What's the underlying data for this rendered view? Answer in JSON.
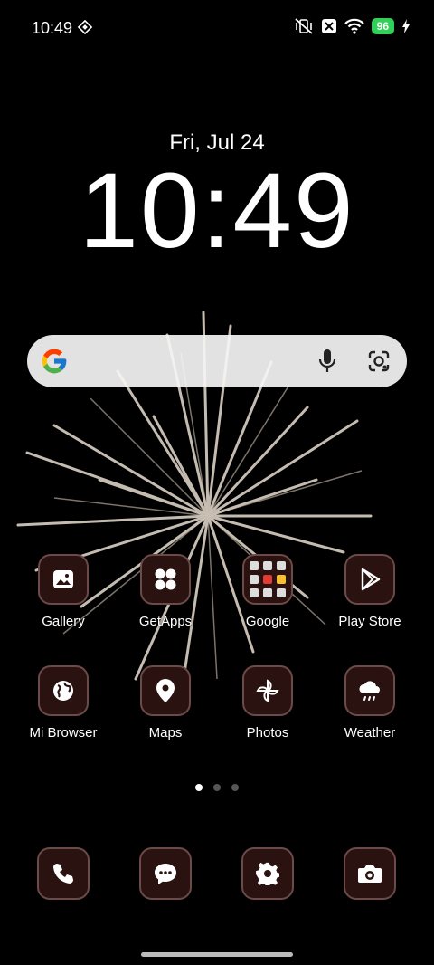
{
  "status_bar": {
    "time": "10:49",
    "battery": "96"
  },
  "lock": {
    "date": "Fri, Jul 24",
    "time": "10:49"
  },
  "search": {
    "placeholder": ""
  },
  "apps_row1": [
    {
      "label": "Gallery",
      "icon": "gallery-icon"
    },
    {
      "label": "GetApps",
      "icon": "getapps-icon"
    },
    {
      "label": "Google",
      "icon": "google-folder-icon"
    },
    {
      "label": "Play Store",
      "icon": "play-store-icon"
    }
  ],
  "apps_row2": [
    {
      "label": "Mi Browser",
      "icon": "globe-icon"
    },
    {
      "label": "Maps",
      "icon": "map-pin-icon"
    },
    {
      "label": "Photos",
      "icon": "pinwheel-icon"
    },
    {
      "label": "Weather",
      "icon": "cloud-rain-icon"
    }
  ],
  "dock": [
    {
      "icon": "phone-icon"
    },
    {
      "icon": "message-icon"
    },
    {
      "icon": "settings-icon"
    },
    {
      "icon": "camera-icon"
    }
  ],
  "page_indicator": {
    "pages": 3,
    "current": 1
  },
  "colors": {
    "icon_bg": "#2a1210",
    "icon_border": "#6b4a48",
    "battery": "#30d158"
  }
}
